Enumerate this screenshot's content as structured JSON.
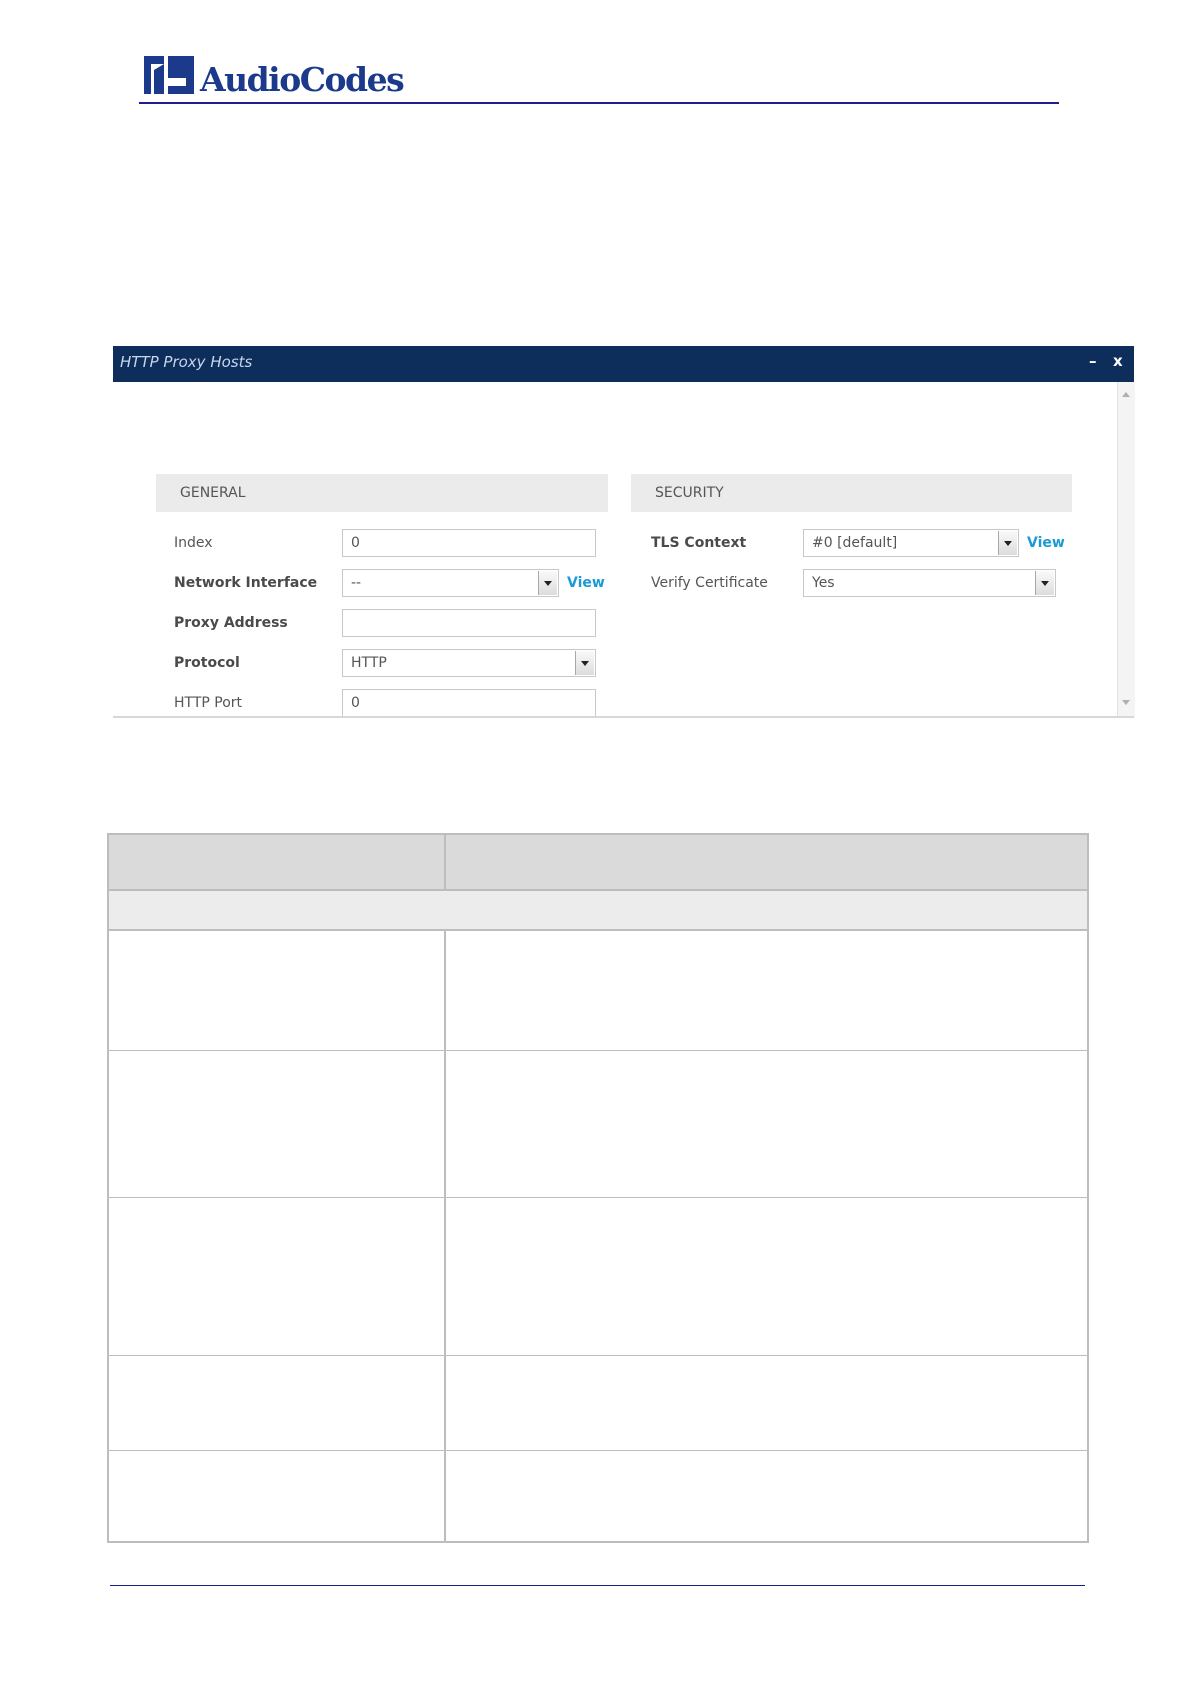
{
  "header": {
    "logo_text": "AudioCodes"
  },
  "dialog": {
    "title": "HTTP Proxy Hosts",
    "minimize_icon": "minimize-icon",
    "close_icon": "close-icon",
    "minimize_label": "–",
    "close_label": "x",
    "general": {
      "heading": "GENERAL",
      "index": {
        "label": "Index",
        "value": "0"
      },
      "network_interface": {
        "label": "Network Interface",
        "value": "--",
        "link": "View"
      },
      "proxy_address": {
        "label": "Proxy Address",
        "value": ""
      },
      "protocol": {
        "label": "Protocol",
        "value": "HTTP"
      },
      "http_port": {
        "label": "HTTP Port",
        "value": "0"
      }
    },
    "security": {
      "heading": "SECURITY",
      "tls_context": {
        "label": "TLS Context",
        "value": "#0 [default]",
        "link": "View"
      },
      "verify_certificate": {
        "label": "Verify Certificate",
        "value": "Yes"
      }
    }
  },
  "colors": {
    "titlebar": "#0d2d5b",
    "link": "#1a9ad6",
    "brand": "#1b3a8c"
  }
}
